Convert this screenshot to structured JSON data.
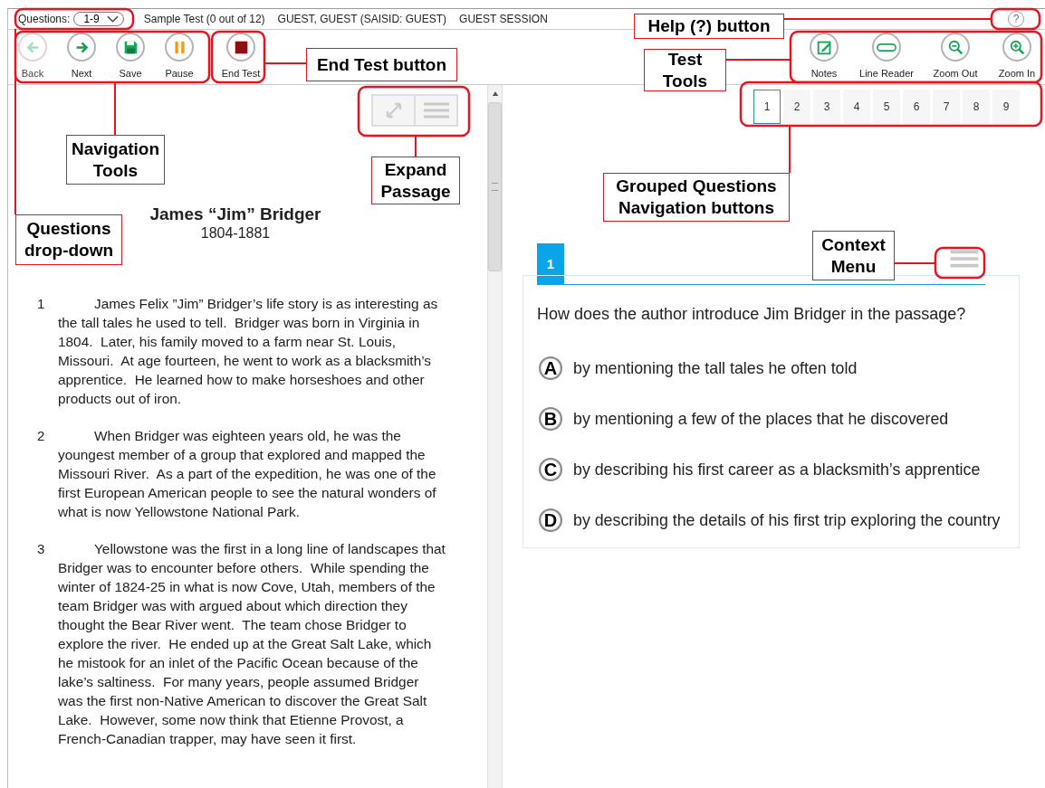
{
  "header": {
    "questions_label": "Questions:",
    "questions_range": "1-9",
    "test_name": "Sample Test (0 out of 12)",
    "student": "GUEST, GUEST (SAISID: GUEST)",
    "session": "GUEST SESSION",
    "help": "?"
  },
  "nav_tools": [
    {
      "label": "Back",
      "kind": "back",
      "disabled": true
    },
    {
      "label": "Next",
      "kind": "next",
      "disabled": false
    },
    {
      "label": "Save",
      "kind": "save",
      "disabled": false
    },
    {
      "label": "Pause",
      "kind": "pause",
      "disabled": false
    },
    {
      "label": "End Test",
      "kind": "end",
      "disabled": false
    }
  ],
  "test_tools": [
    {
      "label": "Notes",
      "kind": "notes"
    },
    {
      "label": "Line Reader",
      "kind": "line_reader"
    },
    {
      "label": "Zoom Out",
      "kind": "zoom_out"
    },
    {
      "label": "Zoom In",
      "kind": "zoom_in"
    }
  ],
  "passage": {
    "title": "James “Jim” Bridger",
    "dates": "1804-1881",
    "paragraphs": [
      {
        "number": "1",
        "text": "James Felix ”Jim” Bridger’s life story is as interesting as the tall tales he used to tell.  Bridger was born in Virginia in 1804.  Later, his family moved to a farm near St. Louis, Missouri.  At age fourteen, he went to work as a blacksmith’s apprentice.  He learned how to make horseshoes and other products out of iron."
      },
      {
        "number": "2",
        "text": "When Bridger was eighteen years old, he was the youngest member of a group that explored and mapped the Missouri River.  As a part of the expedition, he was one of the first European American people to see the natural wonders of what is now Yellowstone National Park."
      },
      {
        "number": "3",
        "text": "Yellowstone was the first in a long line of landscapes that Bridger was to encounter before others.  While spending the winter of 1824-25 in what is now Cove, Utah, members of the team Bridger was with argued about which direction they thought the Bear River went.  The team chose Bridger to explore the river.  He ended up at the Great Salt Lake, which he mistook for an inlet of the Pacific Ocean because of the lake’s saltiness.  For many years, people assumed Bridger was the first non-Native American to discover the Great Salt Lake.  However, some now think that Etienne Provost, a French-Canadian trapper, may have seen it first."
      }
    ]
  },
  "question_nav": [
    {
      "label": "1",
      "selected": true
    },
    {
      "label": "2",
      "selected": false
    },
    {
      "label": "3",
      "selected": false
    },
    {
      "label": "4",
      "selected": false
    },
    {
      "label": "5",
      "selected": false
    },
    {
      "label": "6",
      "selected": false
    },
    {
      "label": "7",
      "selected": false
    },
    {
      "label": "8",
      "selected": false
    },
    {
      "label": "9",
      "selected": false
    }
  ],
  "question": {
    "number": "1",
    "prompt": "How does the author introduce Jim Bridger in the passage?",
    "options": [
      {
        "letter": "A",
        "text": "by mentioning the tall tales he often told",
        "selected": false
      },
      {
        "letter": "B",
        "text": "by mentioning a few of the places that he discovered",
        "selected": false
      },
      {
        "letter": "C",
        "text": "by describing his first career as a blacksmith’s apprentice",
        "selected": false
      },
      {
        "letter": "D",
        "text": "by describing the details of his first trip exploring the country",
        "selected": false
      }
    ]
  },
  "callouts": [
    {
      "text": "Help (?) button"
    },
    {
      "text": "End Test button"
    },
    {
      "text": "Test Tools"
    },
    {
      "text": "Navigation Tools"
    },
    {
      "text": "Expand Passage"
    },
    {
      "text": "Grouped Questions Navigation buttons"
    },
    {
      "text": "Questions drop-down"
    },
    {
      "text": "Context Menu"
    }
  ]
}
